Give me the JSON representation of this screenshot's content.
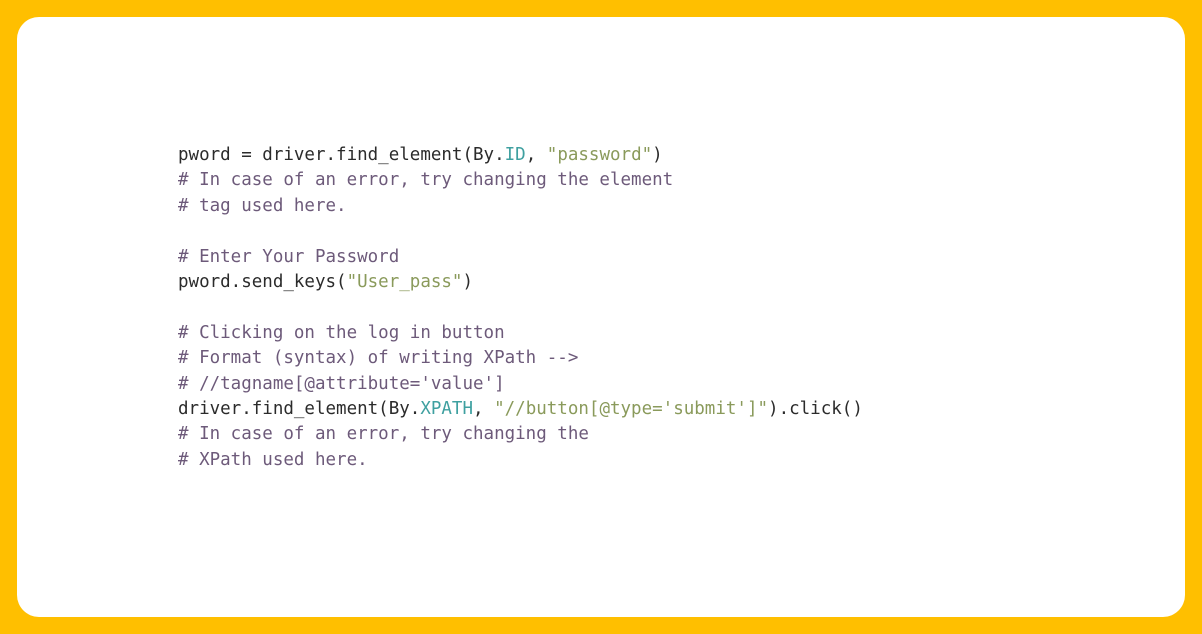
{
  "theme": {
    "frame_color": "#FFBF00",
    "panel_color": "#FFFFFF",
    "plain_color": "#2b2b2b",
    "comment_color": "#6d5a7a",
    "attribute_color": "#3fa0a0",
    "string_color": "#8a9a5b"
  },
  "code": {
    "language": "python",
    "lines": [
      {
        "id": "line-1",
        "tokens": [
          {
            "text": "pword = driver.find_element(By.",
            "type": "plain"
          },
          {
            "text": "ID",
            "type": "attr"
          },
          {
            "text": ", ",
            "type": "plain"
          },
          {
            "text": "\"password\"",
            "type": "string"
          },
          {
            "text": ")",
            "type": "plain"
          }
        ]
      },
      {
        "id": "line-2",
        "tokens": [
          {
            "text": "# In case of an error, try changing the element",
            "type": "comment"
          }
        ]
      },
      {
        "id": "line-3",
        "tokens": [
          {
            "text": "# tag used here.",
            "type": "comment"
          }
        ]
      },
      {
        "id": "line-4",
        "tokens": [
          {
            "text": "",
            "type": "plain"
          }
        ]
      },
      {
        "id": "line-5",
        "tokens": [
          {
            "text": "# Enter Your Password",
            "type": "comment"
          }
        ]
      },
      {
        "id": "line-6",
        "tokens": [
          {
            "text": "pword.send_keys(",
            "type": "plain"
          },
          {
            "text": "\"User_pass\"",
            "type": "string"
          },
          {
            "text": ")",
            "type": "plain"
          }
        ]
      },
      {
        "id": "line-7",
        "tokens": [
          {
            "text": "",
            "type": "plain"
          }
        ]
      },
      {
        "id": "line-8",
        "tokens": [
          {
            "text": "# Clicking on the log in button",
            "type": "comment"
          }
        ]
      },
      {
        "id": "line-9",
        "tokens": [
          {
            "text": "# Format (syntax) of writing XPath -->",
            "type": "comment"
          }
        ]
      },
      {
        "id": "line-10",
        "tokens": [
          {
            "text": "# //tagname[@attribute='value']",
            "type": "comment"
          }
        ]
      },
      {
        "id": "line-11",
        "tokens": [
          {
            "text": "driver.find_element(By.",
            "type": "plain"
          },
          {
            "text": "XPATH",
            "type": "attr"
          },
          {
            "text": ", ",
            "type": "plain"
          },
          {
            "text": "\"//button[@type='submit']\"",
            "type": "string"
          },
          {
            "text": ").click()",
            "type": "plain"
          }
        ]
      },
      {
        "id": "line-12",
        "tokens": [
          {
            "text": "# In case of an error, try changing the",
            "type": "comment"
          }
        ]
      },
      {
        "id": "line-13",
        "tokens": [
          {
            "text": "# XPath used here.",
            "type": "comment"
          }
        ]
      }
    ]
  }
}
